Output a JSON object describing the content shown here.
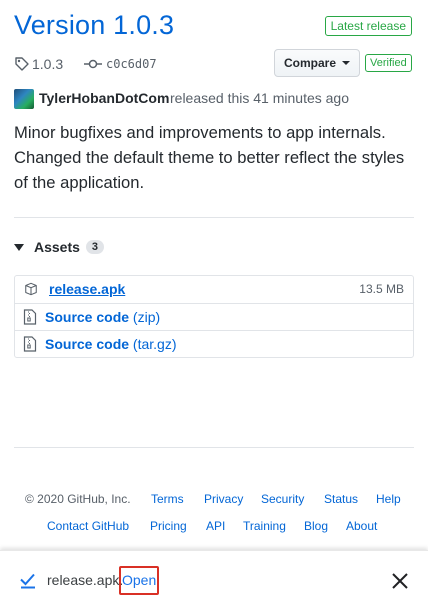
{
  "release": {
    "title": "Version 1.0.3",
    "badge": "Latest release",
    "tag": "1.0.3",
    "commit": "c0c6d07",
    "compare_label": "Compare",
    "verified_label": "Verified",
    "author": "TylerHobanDotCom",
    "released_text": "released this 41 minutes ago",
    "body": [
      "Minor bugfixes and improvements to app internals.",
      "Changed the default theme to better reflect the styles of the application."
    ]
  },
  "assets": {
    "label": "Assets",
    "count": "3",
    "items": [
      {
        "name": "release.apk",
        "suffix": "",
        "size": "13.5 MB",
        "icon": "package-icon"
      },
      {
        "name": "Source code",
        "suffix": "(zip)",
        "size": "",
        "icon": "file-zip-icon"
      },
      {
        "name": "Source code",
        "suffix": "(tar.gz)",
        "size": "",
        "icon": "file-zip-icon"
      }
    ]
  },
  "footer": {
    "copyright": "© 2020 GitHub, Inc.",
    "row1": [
      "Terms",
      "Privacy",
      "Security",
      "Status",
      "Help"
    ],
    "row2": [
      "Contact GitHub",
      "Pricing",
      "API",
      "Training",
      "Blog",
      "About"
    ]
  },
  "download_bar": {
    "file_name": "release.apk.",
    "open_label": "Open",
    "icons": [
      "check-icon",
      "close-icon"
    ],
    "highlight_color": "#d93025"
  },
  "colors": {
    "link": "#0366d6",
    "badge_green": "#28a745",
    "text": "#24292e",
    "muted": "#586069"
  }
}
